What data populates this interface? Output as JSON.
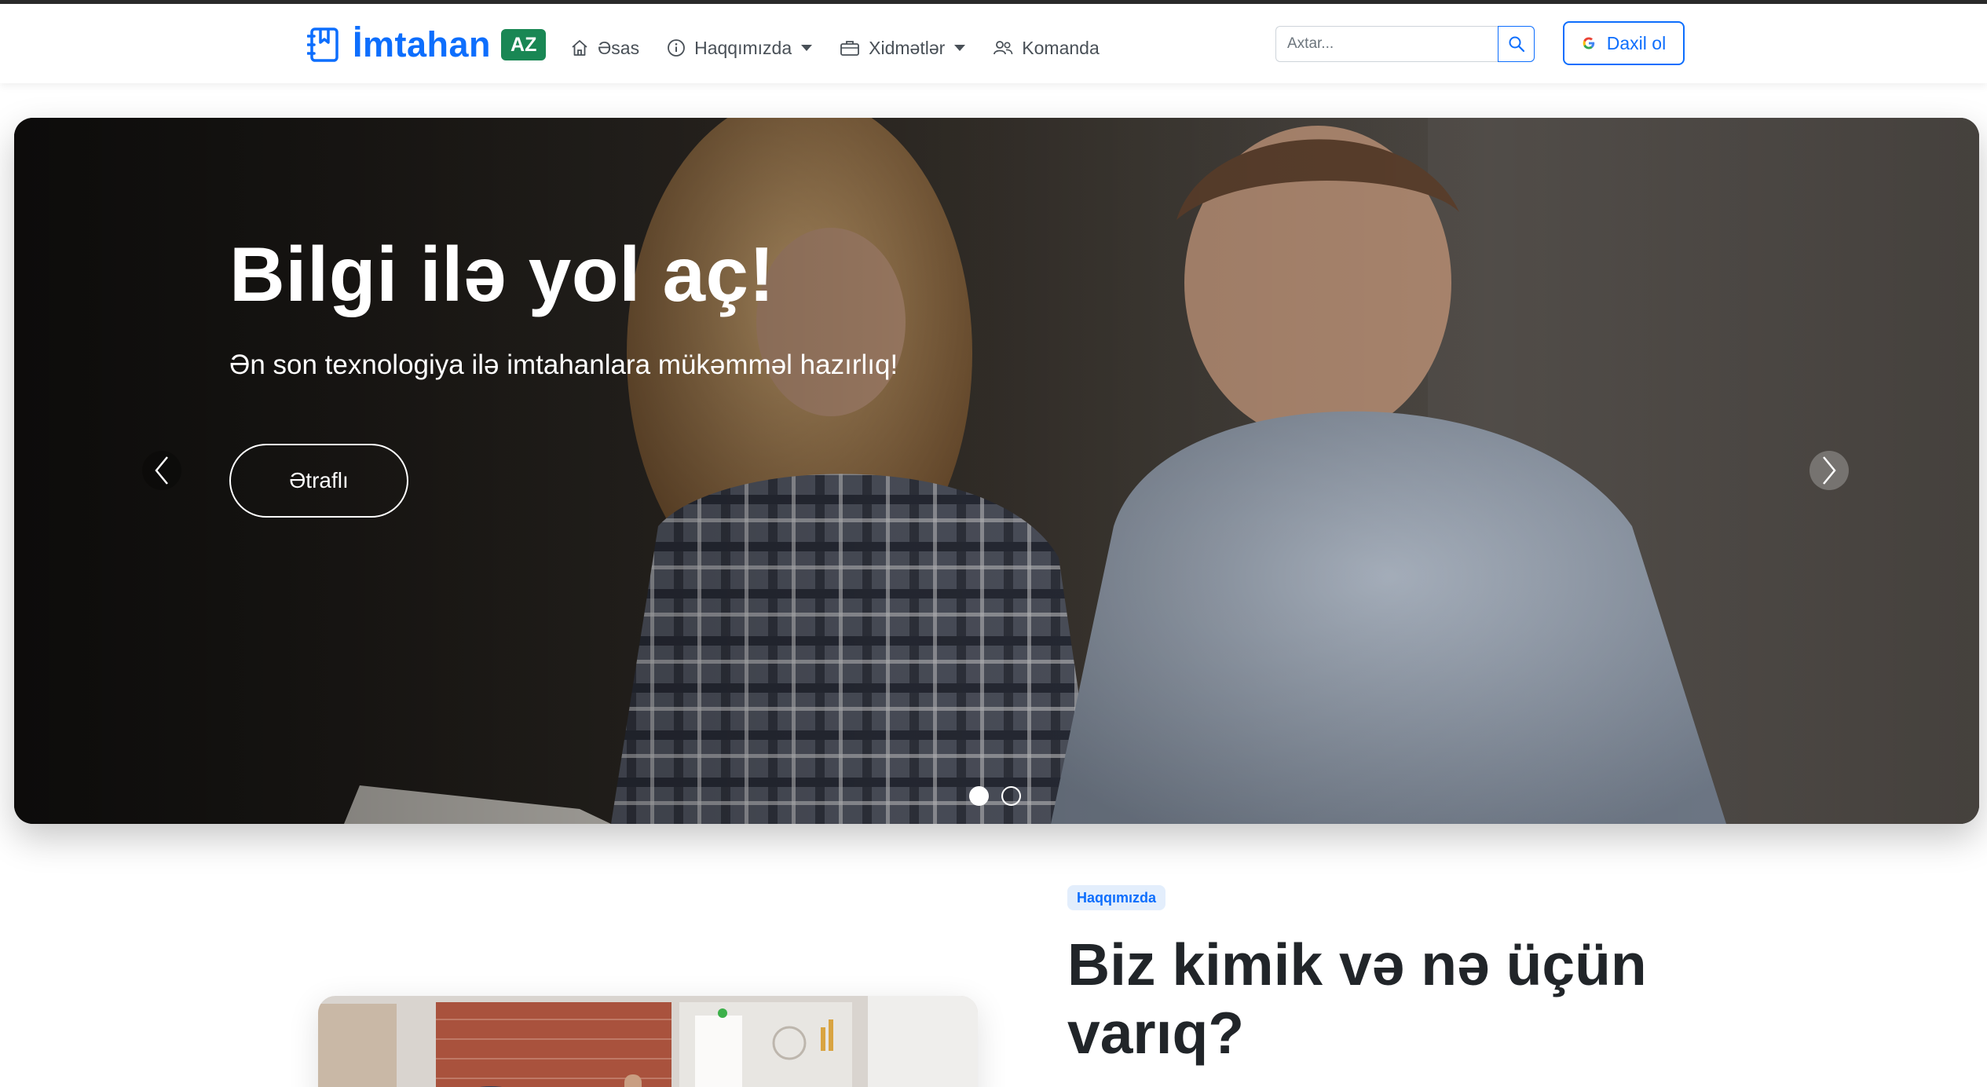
{
  "brand": {
    "name": "İmtahan",
    "badge": "AZ"
  },
  "nav": {
    "items": [
      {
        "label": "Əsas",
        "icon": "home-icon"
      },
      {
        "label": "Haqqımızda",
        "icon": "info-icon",
        "dropdown": true
      },
      {
        "label": "Xidmətlər",
        "icon": "briefcase-icon",
        "dropdown": true
      },
      {
        "label": "Komanda",
        "icon": "people-icon"
      }
    ]
  },
  "search": {
    "placeholder": "Axtar..."
  },
  "login": {
    "label": "Daxil ol",
    "icon": "google-icon"
  },
  "hero": {
    "title": "Bilgi ilə yol aç!",
    "subtitle": "Ən son texnologiya ilə imtahanlara mükəmməl hazırlıq!",
    "cta": "Ətraflı",
    "slides_total": 2,
    "active_slide": 1
  },
  "about": {
    "badge": "Haqqımızda",
    "title": "Biz kimik və nə üçün varıq?"
  },
  "colors": {
    "primary": "#0d6efd",
    "badge_green": "#198754"
  }
}
